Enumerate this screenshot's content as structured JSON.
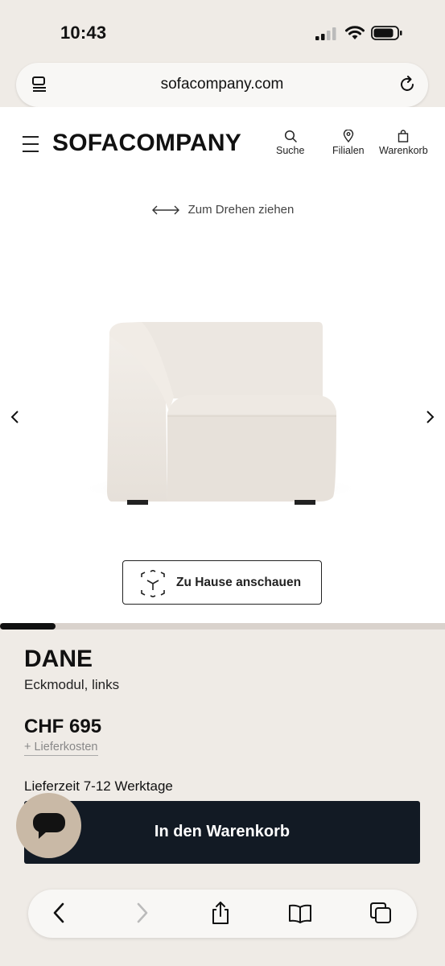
{
  "status_bar": {
    "time": "10:43"
  },
  "browser": {
    "url": "sofacompany.com"
  },
  "header": {
    "logo": "SOFACOMPANY",
    "nav": [
      {
        "label": "Suche",
        "icon": "search-icon"
      },
      {
        "label": "Filialen",
        "icon": "location-pin-icon"
      },
      {
        "label": "Warenkorb",
        "icon": "shopping-bag-icon"
      }
    ]
  },
  "viewer": {
    "rotate_hint": "Zum Drehen ziehen",
    "ar_button_label": "Zu Hause anschauen",
    "progress_fraction": 0.125
  },
  "product": {
    "name": "DANE",
    "subtitle": "Eckmodul, links",
    "price": "CHF 695",
    "delivery_cost": "+ Lieferkosten",
    "delivery_time": "Lieferzeit 7-12 Werktage",
    "cart_button_label": "In den Warenkorb"
  },
  "colors": {
    "background": "#efebe6",
    "cart_button": "#121a24",
    "chat_button": "#c9b9a6"
  }
}
